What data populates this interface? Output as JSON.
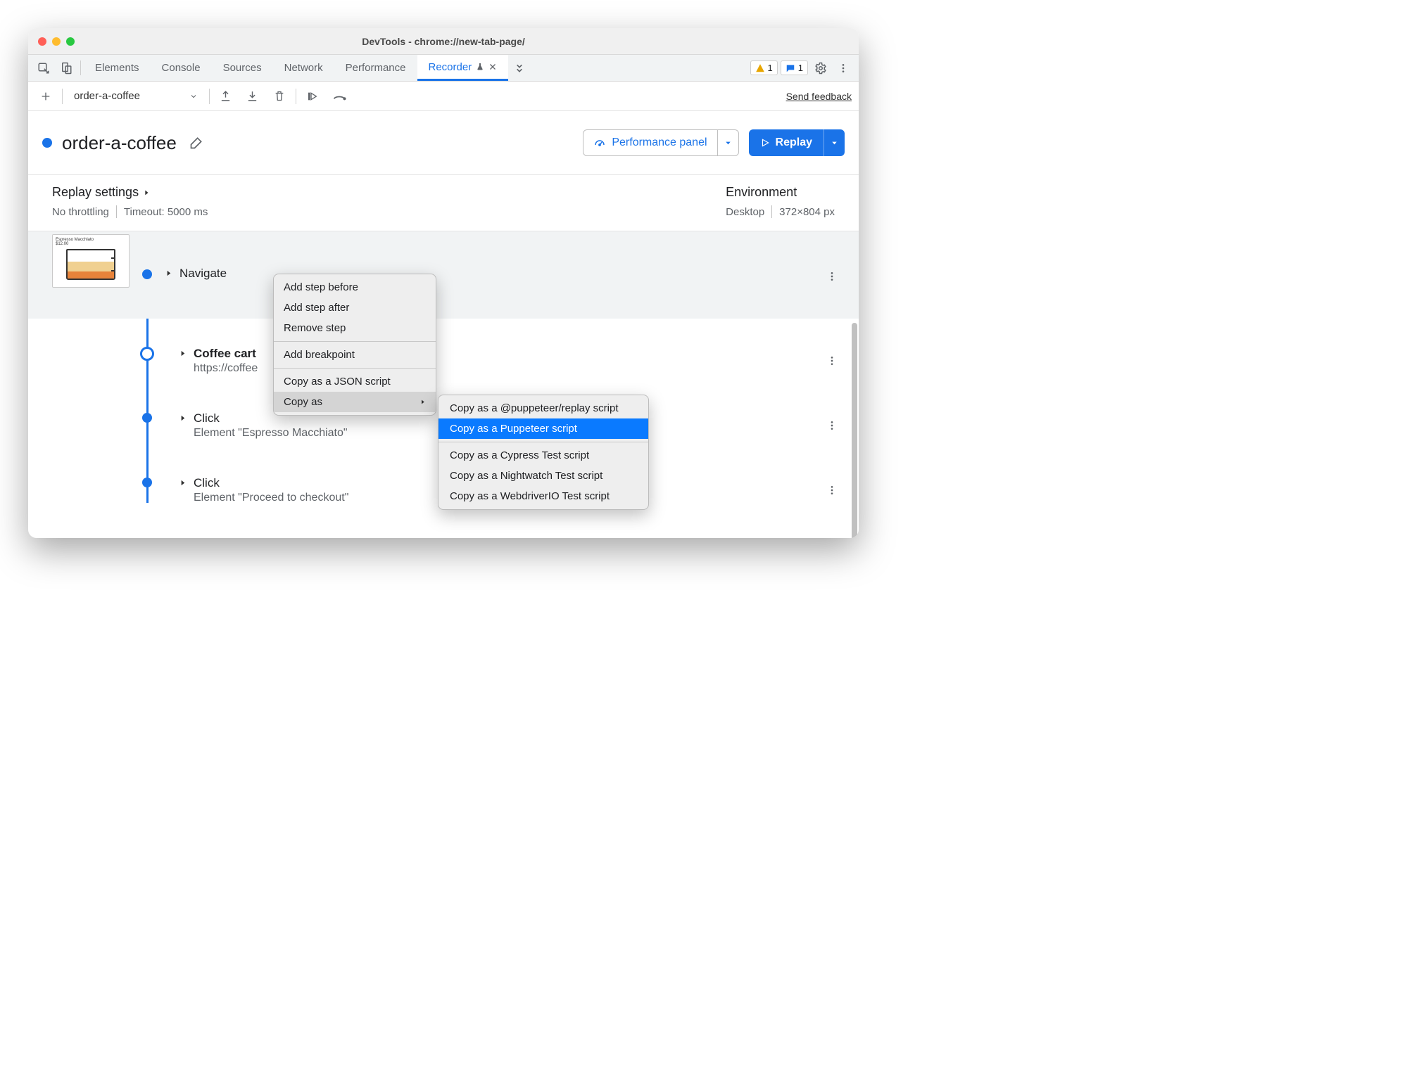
{
  "window": {
    "title": "DevTools - chrome://new-tab-page/"
  },
  "tabs": {
    "items": [
      "Elements",
      "Console",
      "Sources",
      "Network",
      "Performance",
      "Recorder"
    ],
    "warn_count": "1",
    "chat_count": "1"
  },
  "toolbar": {
    "recording_name": "order-a-coffee",
    "feedback": "Send feedback"
  },
  "header": {
    "title": "order-a-coffee",
    "perf_button": "Performance panel",
    "replay_button": "Replay"
  },
  "subheader": {
    "replay_title": "Replay settings",
    "throttling": "No throttling",
    "timeout": "Timeout: 5000 ms",
    "env_title": "Environment",
    "device": "Desktop",
    "viewport": "372×804 px"
  },
  "thumb": {
    "label": "Espresso Macchiato",
    "price": "$12.00"
  },
  "steps": [
    {
      "title": "Navigate",
      "sub": ""
    },
    {
      "title": "Coffee cart",
      "sub": "https://coffee",
      "bold": true
    },
    {
      "title": "Click",
      "sub": "Element \"Espresso Macchiato\""
    },
    {
      "title": "Click",
      "sub": "Element \"Proceed to checkout\""
    }
  ],
  "menu1": {
    "g1": [
      "Add step before",
      "Add step after",
      "Remove step"
    ],
    "g2": [
      "Add breakpoint"
    ],
    "g3": [
      "Copy as a JSON script",
      "Copy as"
    ]
  },
  "menu2": {
    "g1": [
      "Copy as a @puppeteer/replay script",
      "Copy as a Puppeteer script"
    ],
    "g2": [
      "Copy as a Cypress Test script",
      "Copy as a Nightwatch Test script",
      "Copy as a WebdriverIO Test script"
    ]
  }
}
